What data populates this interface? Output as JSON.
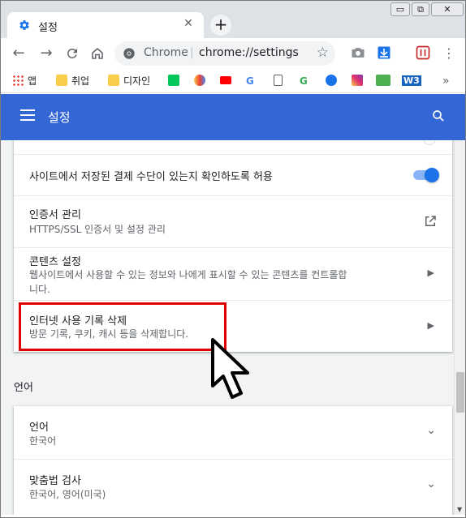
{
  "tab": {
    "title": "설정",
    "close": "✕"
  },
  "window_controls": {
    "minimize": "▭",
    "restore": "⧉",
    "close": "✕"
  },
  "toolbar": {
    "site_label": "Chrome",
    "separator": "|",
    "url": "chrome://settings"
  },
  "bookmarks": [
    {
      "label": "앱",
      "color": "#ea4335"
    },
    {
      "label": "취업",
      "color": "#f9ce4a"
    },
    {
      "label": "디자인",
      "color": "#f9ce4a"
    }
  ],
  "header": {
    "title": "설정"
  },
  "settings": {
    "payment_row": {
      "title": "사이트에서 저장된 결제 수단이 있는지 확인하도록 허용",
      "toggle_on": true
    },
    "cert_row": {
      "title": "인증서 관리",
      "subtitle": "HTTPS/SSL 인증서 및 설정 관리"
    },
    "content_row": {
      "title": "콘텐츠 설정",
      "subtitle_line1": "웹사이트에서 사용할 수 있는 정보와 나에게 표시할 수 있는 콘텐츠를 컨트롤합",
      "subtitle_line2": "니다."
    },
    "clear_row": {
      "title": "인터넷 사용 기록 삭제",
      "subtitle": "방문 기록, 쿠키, 캐시 등을 삭제합니다."
    }
  },
  "languages_section": {
    "label": "언어",
    "language_row": {
      "title": "언어",
      "subtitle": "한국어"
    },
    "spell_row": {
      "title": "맞춤법 검사",
      "subtitle": "한국어, 영어(미국)"
    }
  },
  "colors": {
    "header": "#3367d6",
    "accent": "#1a73e8",
    "highlight": "#e00000"
  }
}
